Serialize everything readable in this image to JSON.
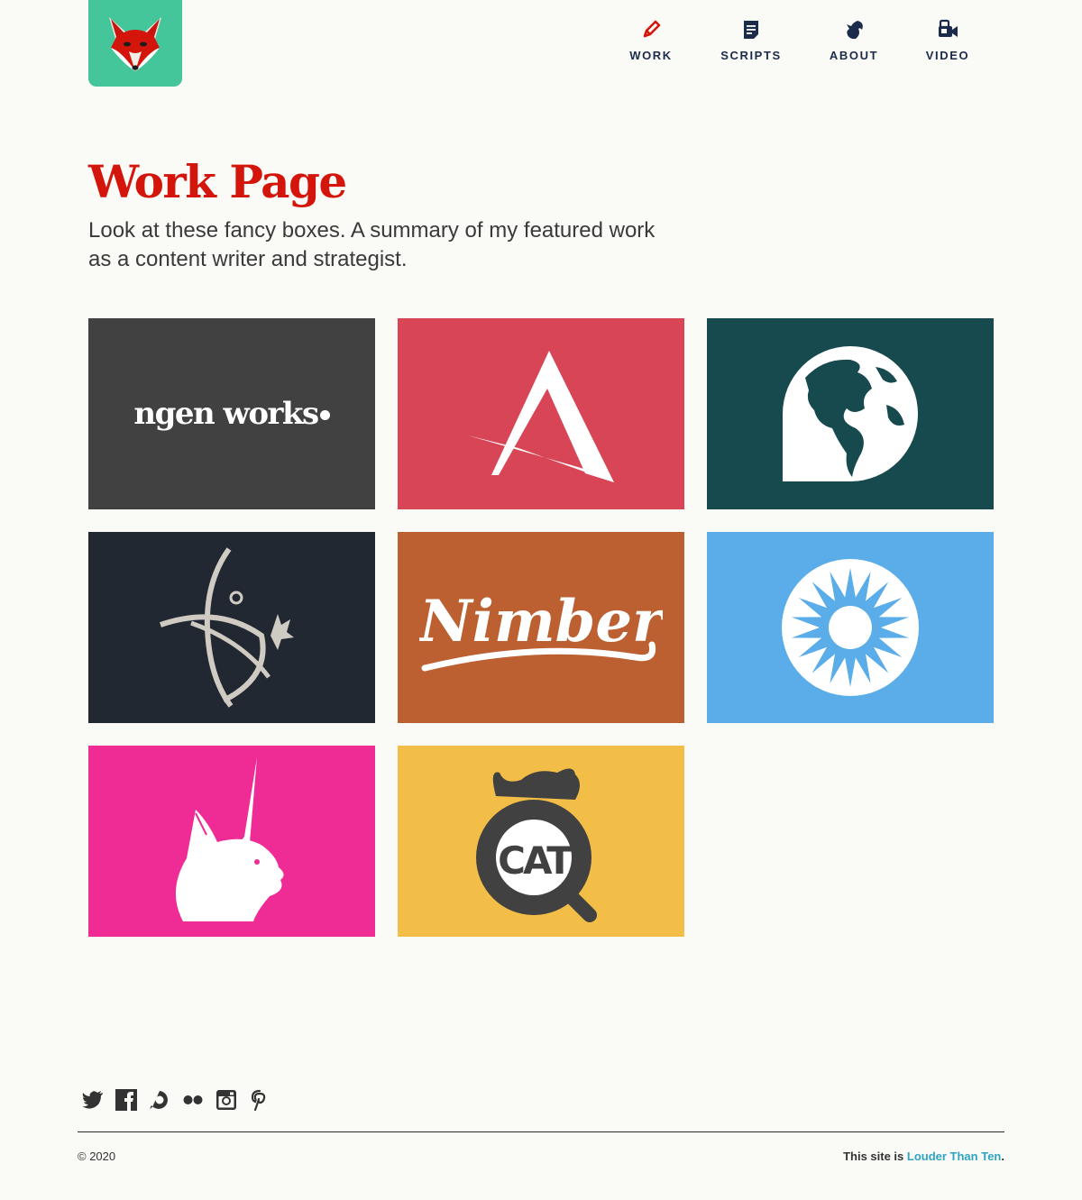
{
  "header": {
    "logo_icon": "fox-head-icon",
    "nav": [
      {
        "label": "WORK",
        "icon": "pencil-icon",
        "color": "#d4150b"
      },
      {
        "label": "SCRIPTS",
        "icon": "document-icon",
        "color": "#1b2b4a"
      },
      {
        "label": "ABOUT",
        "icon": "squirrel-icon",
        "color": "#1b2b4a"
      },
      {
        "label": "VIDEO",
        "icon": "video-camera-icon",
        "color": "#1b2b4a"
      }
    ]
  },
  "main": {
    "title": "Work Page",
    "intro_line1": "Look at these fancy boxes. A summary of my featured work",
    "intro_line2": "as a content writer and strategist.",
    "tiles": [
      {
        "name": "ngen works",
        "text": "ngen works",
        "bg": "#414141"
      },
      {
        "name": "A logo",
        "icon": "triangle-a-icon",
        "bg": "#d84557"
      },
      {
        "name": "globe",
        "icon": "globe-icon",
        "bg": "#174a4e"
      },
      {
        "name": "crest",
        "icon": "crest-icon",
        "bg": "#222831"
      },
      {
        "name": "Nimber",
        "text": "Nimber",
        "bg": "#bc5f31"
      },
      {
        "name": "sun",
        "icon": "sun-icon",
        "bg": "#5aade9"
      },
      {
        "name": "unicorn cat",
        "icon": "unicorn-cat-icon",
        "bg": "#ef2c96"
      },
      {
        "name": "CAT",
        "text": "CAT",
        "bg": "#f2be47"
      }
    ]
  },
  "footer": {
    "social": [
      "twitter-icon",
      "facebook-icon",
      "disqus-icon",
      "flickr-icon",
      "instagram-icon",
      "pinterest-icon"
    ],
    "copyright": "© 2020",
    "credit_prefix": "This site is ",
    "credit_link": "Louder Than Ten",
    "credit_suffix": ".",
    "link_color": "#2fa4c2"
  }
}
